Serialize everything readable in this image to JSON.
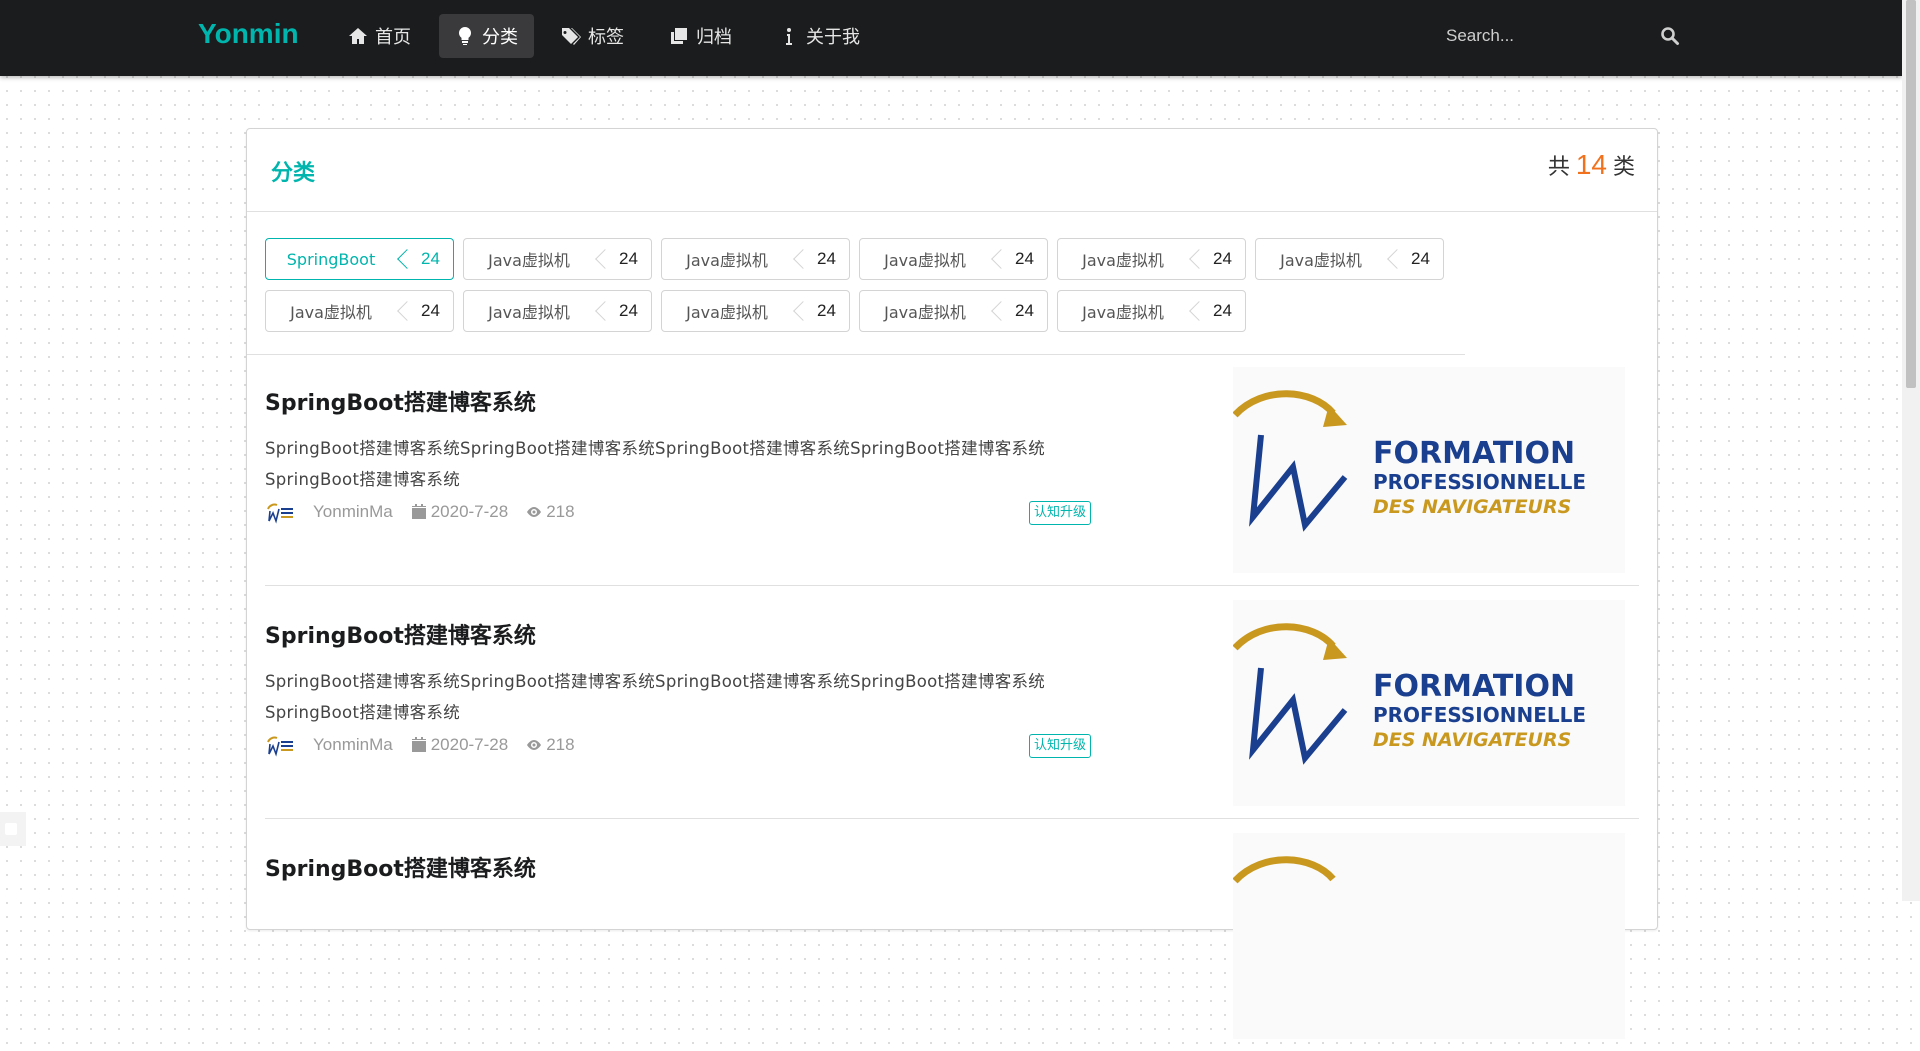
{
  "brand": "Yonmin",
  "nav": [
    {
      "label": "首页",
      "icon": "home-icon"
    },
    {
      "label": "分类",
      "icon": "lightbulb-icon"
    },
    {
      "label": "标签",
      "icon": "tags-icon"
    },
    {
      "label": "归档",
      "icon": "clone-icon"
    },
    {
      "label": "关于我",
      "icon": "info-icon"
    }
  ],
  "search": {
    "placeholder": "Search...",
    "icon": "search-icon"
  },
  "panel": {
    "title": "分类",
    "count_prefix": "共",
    "count_value": "14",
    "count_suffix": "类"
  },
  "categories": [
    {
      "name": "SpringBoot",
      "count": "24"
    },
    {
      "name": "Java虚拟机",
      "count": "24"
    },
    {
      "name": "Java虚拟机",
      "count": "24"
    },
    {
      "name": "Java虚拟机",
      "count": "24"
    },
    {
      "name": "Java虚拟机",
      "count": "24"
    },
    {
      "name": "Java虚拟机",
      "count": "24"
    },
    {
      "name": "Java虚拟机",
      "count": "24"
    },
    {
      "name": "Java虚拟机",
      "count": "24"
    },
    {
      "name": "Java虚拟机",
      "count": "24"
    },
    {
      "name": "Java虚拟机",
      "count": "24"
    },
    {
      "name": "Java虚拟机",
      "count": "24"
    }
  ],
  "posts": [
    {
      "title": "SpringBoot搭建博客系统",
      "desc": "SpringBoot搭建博客系统SpringBoot搭建博客系统SpringBoot搭建博客系统SpringBoot搭建博客系统SpringBoot搭建博客系统",
      "author": "YonminMa",
      "date": "2020-7-28",
      "views": "218",
      "tag": "认知升级",
      "image_text": [
        "FORMATION",
        "PROFESSIONNELLE",
        "DES NAVIGATEURS"
      ]
    },
    {
      "title": "SpringBoot搭建博客系统",
      "desc": "SpringBoot搭建博客系统SpringBoot搭建博客系统SpringBoot搭建博客系统SpringBoot搭建博客系统SpringBoot搭建博客系统",
      "author": "YonminMa",
      "date": "2020-7-28",
      "views": "218",
      "tag": "认知升级",
      "image_text": [
        "FORMATION",
        "PROFESSIONNELLE",
        "DES NAVIGATEURS"
      ]
    },
    {
      "title": "SpringBoot搭建博客系统",
      "desc": "",
      "author": "",
      "date": "",
      "views": "",
      "tag": "",
      "image_text": []
    }
  ],
  "colors": {
    "accent": "#00b5ad",
    "count": "#f2711c",
    "nav_bg": "#1b1c1d",
    "logo_blue": "#1b3f8f",
    "logo_gold": "#c9981e"
  }
}
